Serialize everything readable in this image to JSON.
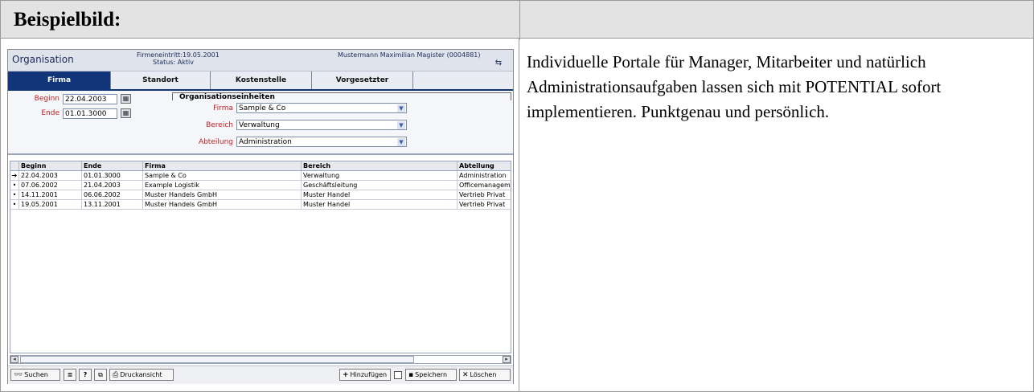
{
  "header": {
    "title": "Beispielbild:"
  },
  "description": "Individuelle Portale für Manager, Mitarbeiter und natürlich Administrationsaufgaben lassen sich mit POTENTIAL sofort implementieren. Punktgenau und persönlich.",
  "app": {
    "title": "Organisation",
    "entry": "Firmeneintritt:19.05.2001",
    "status": "Status: Aktiv",
    "user": "Mustermann Maximilian Magister (0004881)",
    "tabs": [
      {
        "label": "Firma",
        "active": true
      },
      {
        "label": "Standort",
        "active": false
      },
      {
        "label": "Kostenstelle",
        "active": false
      },
      {
        "label": "Vorgesetzter",
        "active": false
      }
    ],
    "form": {
      "beginn_label": "Beginn",
      "beginn_value": "22.04.2003",
      "ende_label": "Ende",
      "ende_value": "01.01.3000",
      "org_heading": "Organisationseinheiten",
      "firma_label": "Firma",
      "firma_value": "Sample & Co",
      "bereich_label": "Bereich",
      "bereich_value": "Verwaltung",
      "abteilung_label": "Abteilung",
      "abteilung_value": "Administration"
    },
    "grid": {
      "columns": [
        "Beginn",
        "Ende",
        "Firma",
        "Bereich",
        "Abteilung"
      ],
      "rows": [
        {
          "marker": "➔",
          "cells": [
            "22.04.2003",
            "01.01.3000",
            "Sample & Co",
            "Verwaltung",
            "Administration"
          ]
        },
        {
          "marker": "•",
          "cells": [
            "07.06.2002",
            "21.04.2003",
            "Example Logistik",
            "Geschäftsleitung",
            "Officemanagement"
          ]
        },
        {
          "marker": "•",
          "cells": [
            "14.11.2001",
            "06.06.2002",
            "Muster Handels GmbH",
            "Muster Handel",
            "Vertrieb Privat"
          ]
        },
        {
          "marker": "•",
          "cells": [
            "19.05.2001",
            "13.11.2001",
            "Muster Handels GmbH",
            "Muster Handel",
            "Vertrieb Privat"
          ]
        }
      ]
    },
    "toolbar": {
      "search": "Suchen",
      "help": "?",
      "print": "Druckansicht",
      "add": "Hinzufügen",
      "save": "Speichern",
      "delete": "Löschen"
    }
  }
}
